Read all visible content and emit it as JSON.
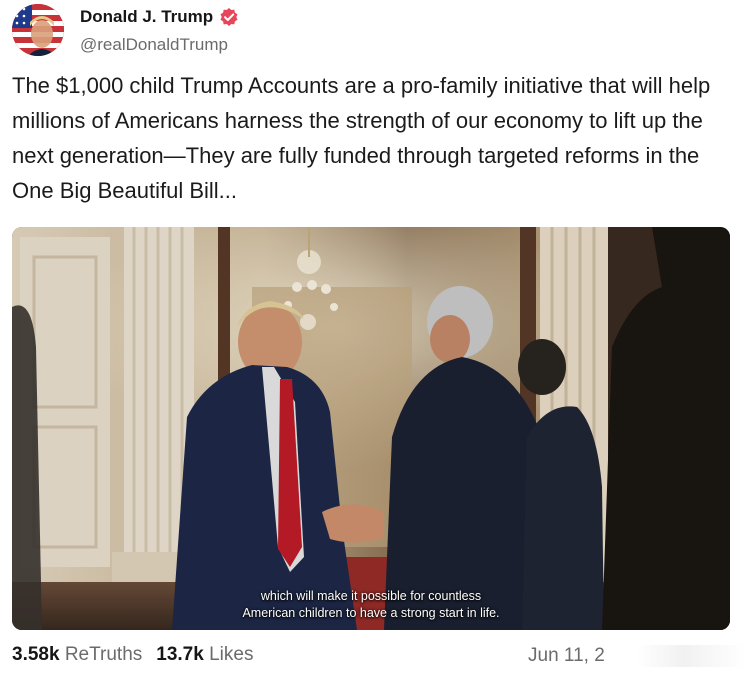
{
  "author": {
    "display_name": "Donald J. Trump",
    "handle": "@realDonaldTrump",
    "verified": true,
    "verified_color": "#e8465b"
  },
  "post": {
    "text": "The $1,000 child Trump Accounts are a pro-family initiative that will help millions of Americans harness the strength of our economy to lift up the next generation—They are fully funded through targeted reforms in the One Big Beautiful Bill..."
  },
  "media": {
    "caption_line1": "which will make it possible for countless",
    "caption_line2": "American children to have a strong start in life."
  },
  "stats": {
    "retruths_count": "3.58k",
    "retruths_label": "ReTruths",
    "likes_count": "13.7k",
    "likes_label": "Likes",
    "timestamp": "Jun 11, 2"
  },
  "icons": [
    "avatar",
    "verified-badge-icon"
  ]
}
